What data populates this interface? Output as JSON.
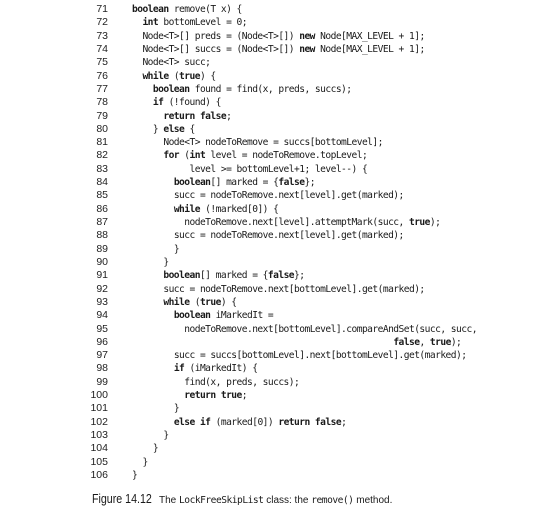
{
  "code": {
    "indent_unit": "  ",
    "lines": [
      {
        "num": "71",
        "indent": 0,
        "tokens": [
          [
            "kw",
            "boolean"
          ],
          [
            "t",
            " remove(T x) {"
          ]
        ]
      },
      {
        "num": "72",
        "indent": 1,
        "tokens": [
          [
            "kw",
            "int"
          ],
          [
            "t",
            " bottomLevel = 0;"
          ]
        ]
      },
      {
        "num": "73",
        "indent": 1,
        "tokens": [
          [
            "t",
            "Node<T>[] preds = (Node<T>[]) "
          ],
          [
            "kw",
            "new"
          ],
          [
            "t",
            " Node[MAX_LEVEL + 1];"
          ]
        ]
      },
      {
        "num": "74",
        "indent": 1,
        "tokens": [
          [
            "t",
            "Node<T>[] succs = (Node<T>[]) "
          ],
          [
            "kw",
            "new"
          ],
          [
            "t",
            " Node[MAX_LEVEL + 1];"
          ]
        ]
      },
      {
        "num": "75",
        "indent": 1,
        "tokens": [
          [
            "t",
            "Node<T> succ;"
          ]
        ]
      },
      {
        "num": "76",
        "indent": 1,
        "tokens": [
          [
            "kw",
            "while"
          ],
          [
            "t",
            " ("
          ],
          [
            "kw",
            "true"
          ],
          [
            "t",
            ") {"
          ]
        ]
      },
      {
        "num": "77",
        "indent": 2,
        "tokens": [
          [
            "kw",
            "boolean"
          ],
          [
            "t",
            " found = find(x, preds, succs);"
          ]
        ]
      },
      {
        "num": "78",
        "indent": 2,
        "tokens": [
          [
            "kw",
            "if"
          ],
          [
            "t",
            " (!found) {"
          ]
        ]
      },
      {
        "num": "79",
        "indent": 3,
        "tokens": [
          [
            "kw",
            "return false"
          ],
          [
            "t",
            ";"
          ]
        ]
      },
      {
        "num": "80",
        "indent": 2,
        "tokens": [
          [
            "t",
            "} "
          ],
          [
            "kw",
            "else"
          ],
          [
            "t",
            " {"
          ]
        ]
      },
      {
        "num": "81",
        "indent": 3,
        "tokens": [
          [
            "t",
            "Node<T> nodeToRemove = succs[bottomLevel];"
          ]
        ]
      },
      {
        "num": "82",
        "indent": 3,
        "tokens": [
          [
            "kw",
            "for"
          ],
          [
            "t",
            " ("
          ],
          [
            "kw",
            "int"
          ],
          [
            "t",
            " level = nodeToRemove.topLevel;"
          ]
        ]
      },
      {
        "num": "83",
        "indent": 3,
        "tokens": [
          [
            "t",
            "     level >= bottomLevel+1; level--) {"
          ]
        ]
      },
      {
        "num": "84",
        "indent": 4,
        "tokens": [
          [
            "kw",
            "boolean"
          ],
          [
            "t",
            "[] marked = {"
          ],
          [
            "kw",
            "false"
          ],
          [
            "t",
            "};"
          ]
        ]
      },
      {
        "num": "85",
        "indent": 4,
        "tokens": [
          [
            "t",
            "succ = nodeToRemove.next[level].get(marked);"
          ]
        ]
      },
      {
        "num": "86",
        "indent": 4,
        "tokens": [
          [
            "kw",
            "while"
          ],
          [
            "t",
            " (!marked[0]) {"
          ]
        ]
      },
      {
        "num": "87",
        "indent": 5,
        "tokens": [
          [
            "t",
            "nodeToRemove.next[level].attemptMark(succ, "
          ],
          [
            "kw",
            "true"
          ],
          [
            "t",
            ");"
          ]
        ]
      },
      {
        "num": "88",
        "indent": 4,
        "tokens": [
          [
            "t",
            "succ = nodeToRemove.next[level].get(marked);"
          ]
        ]
      },
      {
        "num": "89",
        "indent": 4,
        "tokens": [
          [
            "t",
            "}"
          ]
        ]
      },
      {
        "num": "90",
        "indent": 3,
        "tokens": [
          [
            "t",
            "}"
          ]
        ]
      },
      {
        "num": "91",
        "indent": 3,
        "tokens": [
          [
            "kw",
            "boolean"
          ],
          [
            "t",
            "[] marked = {"
          ],
          [
            "kw",
            "false"
          ],
          [
            "t",
            "};"
          ]
        ]
      },
      {
        "num": "92",
        "indent": 3,
        "tokens": [
          [
            "t",
            "succ = nodeToRemove.next[bottomLevel].get(marked);"
          ]
        ]
      },
      {
        "num": "93",
        "indent": 3,
        "tokens": [
          [
            "kw",
            "while"
          ],
          [
            "t",
            " ("
          ],
          [
            "kw",
            "true"
          ],
          [
            "t",
            ") {"
          ]
        ]
      },
      {
        "num": "94",
        "indent": 4,
        "tokens": [
          [
            "kw",
            "boolean"
          ],
          [
            "t",
            " iMarkedIt ="
          ]
        ]
      },
      {
        "num": "95",
        "indent": 5,
        "tokens": [
          [
            "t",
            "nodeToRemove.next[bottomLevel].compareAndSet(succ, succ,"
          ]
        ]
      },
      {
        "num": "96",
        "indent": 5,
        "tokens": [
          [
            "t",
            "                                        "
          ],
          [
            "kw",
            "false"
          ],
          [
            "t",
            ", "
          ],
          [
            "kw",
            "true"
          ],
          [
            "t",
            ");"
          ]
        ]
      },
      {
        "num": "97",
        "indent": 4,
        "tokens": [
          [
            "t",
            "succ = succs[bottomLevel].next[bottomLevel].get(marked);"
          ]
        ]
      },
      {
        "num": "98",
        "indent": 4,
        "tokens": [
          [
            "kw",
            "if"
          ],
          [
            "t",
            " (iMarkedIt) {"
          ]
        ]
      },
      {
        "num": "99",
        "indent": 5,
        "tokens": [
          [
            "t",
            "find(x, preds, succs);"
          ]
        ]
      },
      {
        "num": "100",
        "indent": 5,
        "tokens": [
          [
            "kw",
            "return true"
          ],
          [
            "t",
            ";"
          ]
        ]
      },
      {
        "num": "101",
        "indent": 4,
        "tokens": [
          [
            "t",
            "}"
          ]
        ]
      },
      {
        "num": "102",
        "indent": 4,
        "tokens": [
          [
            "kw",
            "else if"
          ],
          [
            "t",
            " (marked[0]) "
          ],
          [
            "kw",
            "return false"
          ],
          [
            "t",
            ";"
          ]
        ]
      },
      {
        "num": "103",
        "indent": 3,
        "tokens": [
          [
            "t",
            "}"
          ]
        ]
      },
      {
        "num": "104",
        "indent": 2,
        "tokens": [
          [
            "t",
            "}"
          ]
        ]
      },
      {
        "num": "105",
        "indent": 1,
        "tokens": [
          [
            "t",
            "}"
          ]
        ]
      },
      {
        "num": "106",
        "indent": 0,
        "tokens": [
          [
            "t",
            "}"
          ]
        ]
      }
    ]
  },
  "caption": {
    "label": "Figure 14.12",
    "pre": "The ",
    "class_name": "LockFreeSkipList",
    "mid": " class: the ",
    "method_name": "remove()",
    "post": " method."
  }
}
